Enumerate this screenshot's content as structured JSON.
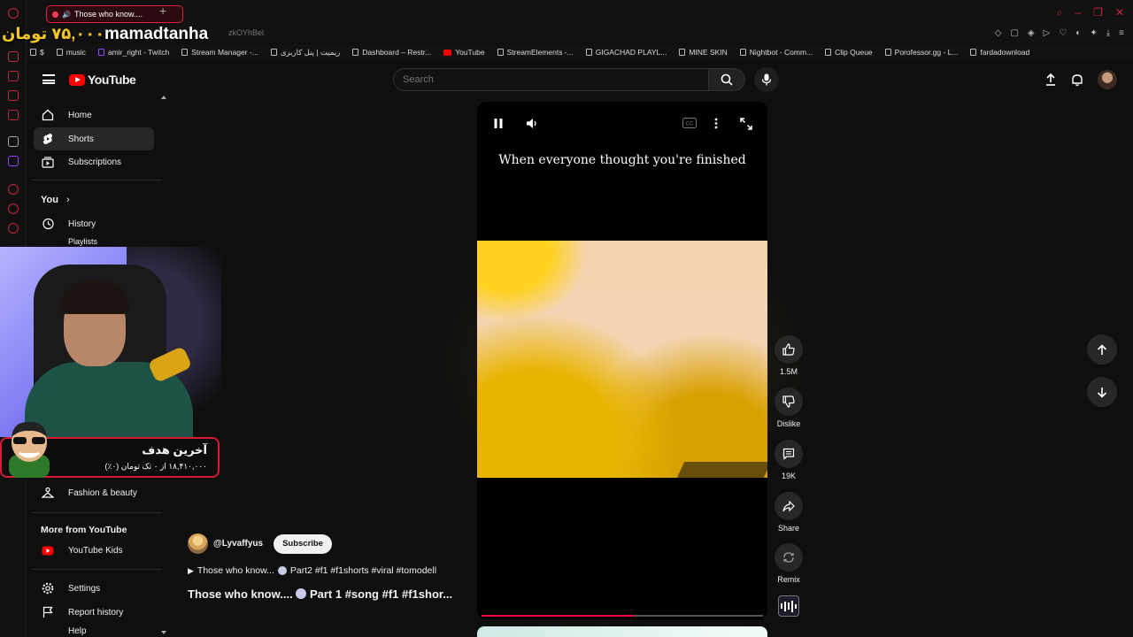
{
  "browser": {
    "tab_title": "Those who know....",
    "url_fragment": "zkOYhBel",
    "bookmarks": [
      "$",
      "music",
      "amir_right - Twitch",
      "Stream Manager -...",
      "ریمیت | پنل کاربری",
      "Dashboard – Restr...",
      "YouTube",
      "StreamElements -...",
      "GIGACHAD PLAYL...",
      "MINE SKIN",
      "Nightbot - Comm...",
      "Clip Queue",
      "Porofessor.gg - L...",
      "fardadownload"
    ]
  },
  "overlay": {
    "price": "۷۵,۰۰۰ تومان",
    "streamer": "mamadtanha",
    "goal_title": "آخرین هدف",
    "goal_sub": "۱۸,۴۱۰,۰۰۰ از ۰ تک تومان (۰٪)"
  },
  "header": {
    "logo": "YouTube",
    "search_placeholder": "Search"
  },
  "sidebar": {
    "items": [
      {
        "label": "Home",
        "icon": "home-icon"
      },
      {
        "label": "Shorts",
        "icon": "shorts-icon",
        "active": true
      },
      {
        "label": "Subscriptions",
        "icon": "subscriptions-icon"
      }
    ],
    "you_label": "You",
    "history": "History",
    "playlists": "Playlists",
    "fashion": "Fashion & beauty",
    "more_title": "More from YouTube",
    "youtube_kids": "YouTube Kids",
    "settings": "Settings",
    "report_history": "Report history",
    "help": "Help"
  },
  "player": {
    "caption": "When everyone thought you're finished",
    "progress_percent": 54
  },
  "actions": {
    "likes": "1.5M",
    "dislike": "Dislike",
    "comments": "19K",
    "share": "Share",
    "remix": "Remix"
  },
  "short": {
    "channel": "@Lyvaffyus",
    "subscribe": "Subscribe",
    "playlist_prefix": "Those who know...",
    "playlist_suffix": "Part2 #f1 #f1shorts #viral #tomodell",
    "title_prefix": "Those who know....",
    "title_suffix": "Part 1 #song #f1 #f1shor..."
  }
}
